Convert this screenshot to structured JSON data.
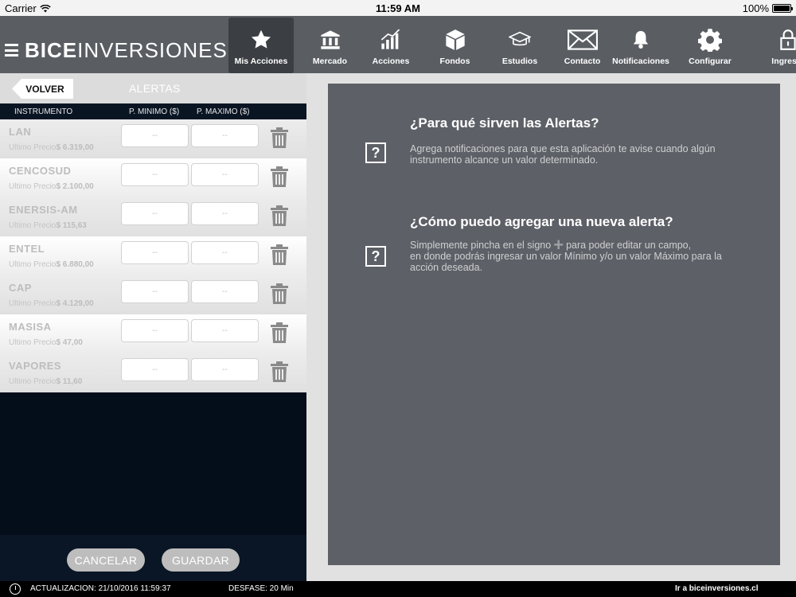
{
  "status_bar": {
    "carrier": "Carrier",
    "time": "11:59 AM",
    "battery": "100%"
  },
  "brand": {
    "bold": "BICE",
    "light": "INVERSIONES"
  },
  "nav": [
    {
      "label": "Mis Acciones",
      "icon": "star-icon",
      "active": true
    },
    {
      "label": "Mercado",
      "icon": "bank-icon"
    },
    {
      "label": "Acciones",
      "icon": "bar-chart-icon"
    },
    {
      "label": "Fondos",
      "icon": "box-icon"
    },
    {
      "label": "Estudios",
      "icon": "graduation-cap-icon"
    },
    {
      "label": "Contacto",
      "icon": "envelope-icon"
    },
    {
      "label": "Notificaciones",
      "icon": "bell-icon"
    },
    {
      "label": "Configurar",
      "icon": "gear-icon"
    },
    {
      "label": "Ingresar",
      "icon": "lock-icon"
    }
  ],
  "alerts": {
    "back_label": "VOLVER",
    "title": "ALERTAS",
    "columns": {
      "instrument": "INSTRUMENTO",
      "min": "P. MINIMO ($)",
      "max": "P. MAXIMO ($)"
    },
    "price_label": "Ultimo Precio",
    "rows": [
      {
        "name": "LAN",
        "price": "$ 6.319,00",
        "min": "--",
        "max": "--"
      },
      {
        "name": "CENCOSUD",
        "price": "$ 2.100,00",
        "min": "--",
        "max": "--"
      },
      {
        "name": "ENERSIS-AM",
        "price": "$ 115,63",
        "min": "--",
        "max": "--"
      },
      {
        "name": "ENTEL",
        "price": "$ 6.880,00",
        "min": "--",
        "max": "--"
      },
      {
        "name": "CAP",
        "price": "$ 4.129,00",
        "min": "--",
        "max": "--"
      },
      {
        "name": "MASISA",
        "price": "$ 47,00",
        "min": "--",
        "max": "--"
      },
      {
        "name": "VAPORES",
        "price": "$ 11,60",
        "min": "--",
        "max": "--"
      }
    ],
    "cancel_label": "CANCELAR",
    "save_label": "GUARDAR"
  },
  "help": {
    "q1_title": "¿Para qué sirven las Alertas?",
    "q1_text": "Agrega notificaciones para que esta aplicación te avise cuando algún instrumento alcance un valor determinado.",
    "q2_title": "¿Cómo puedo agregar una nueva alerta?",
    "q2_text_before": "Simplemente pincha en el signo",
    "q2_text_after": "para poder editar un campo,",
    "q2_text_rest": "en donde podrás ingresar un valor Mínimo y/o un valor Máximo para la acción deseada.",
    "icon_glyph": "?"
  },
  "footer": {
    "updated": "ACTUALIZACION:  21/10/2016 11:59:37",
    "offset": "DESFASE: 20 Min",
    "link": "Ir a biceinversiones.cl"
  },
  "colors": {
    "nav_bg": "#5a5e63",
    "card_bg": "#5d6066",
    "panel_bg": "#040d1a"
  }
}
